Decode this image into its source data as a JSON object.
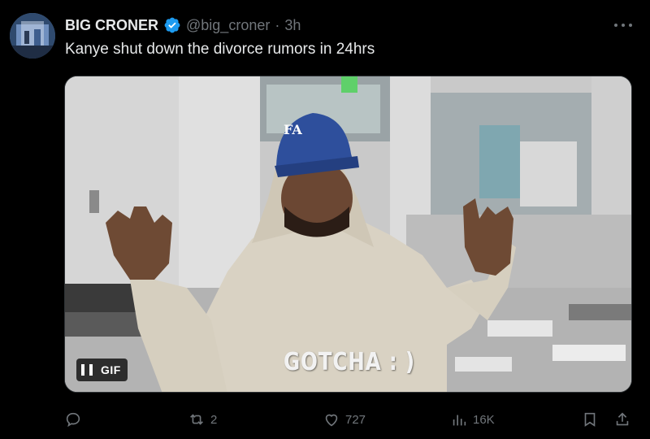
{
  "tweet": {
    "display_name": "BIG CRONER",
    "handle": "@big_croner",
    "separator": "·",
    "time": "3h",
    "text": "Kanye shut down the divorce rumors in 24hrs",
    "verified": true
  },
  "media": {
    "type_label": "GIF",
    "caption": "GOTCHA : )",
    "hat_text": "FA"
  },
  "actions": {
    "replies": "",
    "retweets": "2",
    "likes": "727",
    "views": "16K"
  },
  "colors": {
    "background": "#000000",
    "text_primary": "#e7e9ea",
    "text_secondary": "#71767b",
    "verified_blue": "#1d9bf0"
  },
  "icons": [
    "avatar",
    "verified-badge-icon",
    "more-icon",
    "pause-icon",
    "reply-icon",
    "retweet-icon",
    "like-icon",
    "views-icon",
    "bookmark-icon",
    "share-icon"
  ]
}
